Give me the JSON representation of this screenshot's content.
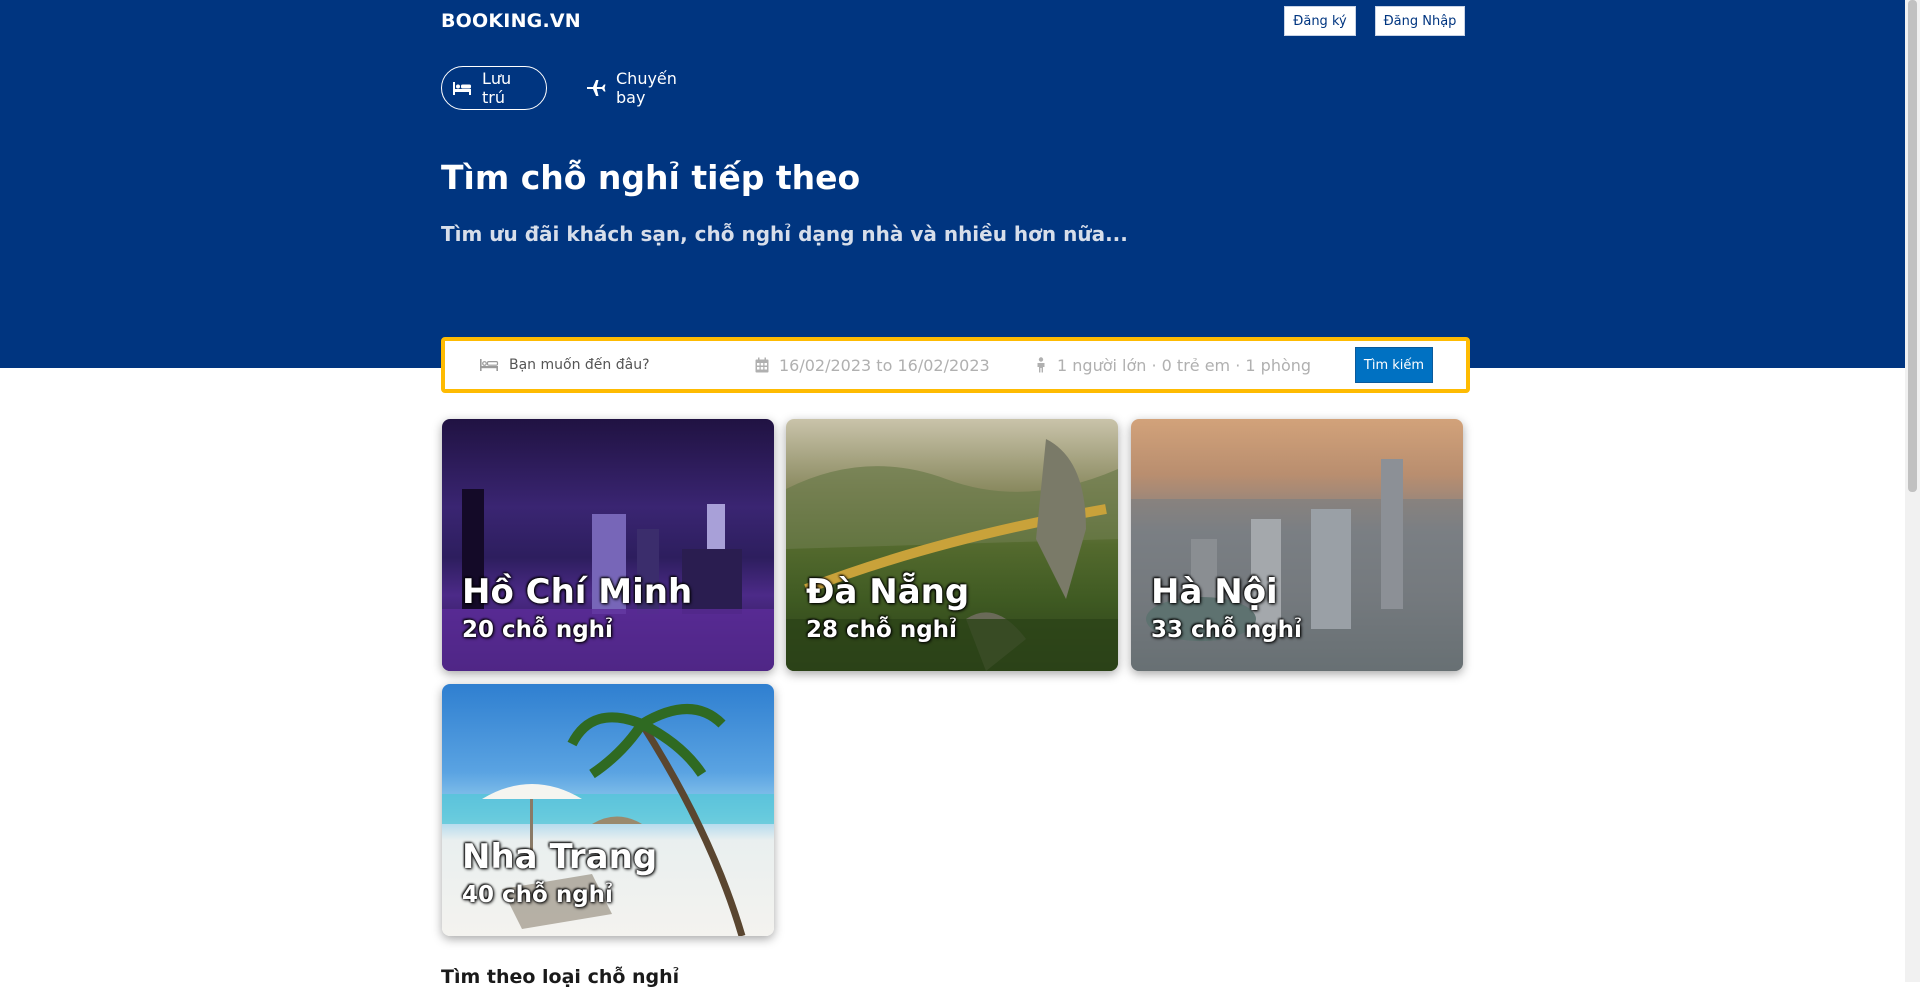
{
  "header": {
    "brand": "BOOKING.VN",
    "register_label": "Đăng ký",
    "login_label": "Đăng Nhập"
  },
  "nav": {
    "tabs": [
      {
        "label": "Lưu trú",
        "icon": "bed-icon",
        "active": true
      },
      {
        "label": "Chuyến bay",
        "icon": "plane-icon",
        "active": false
      }
    ]
  },
  "hero": {
    "title": "Tìm chỗ nghỉ tiếp theo",
    "subtitle": "Tìm ưu đãi khách sạn, chỗ nghỉ dạng nhà và nhiều hơn nữa..."
  },
  "search": {
    "destination_placeholder": "Bạn muốn đến đâu?",
    "dates": "16/02/2023 to 16/02/2023",
    "guests": "1 người lớn · 0 trẻ em · 1 phòng",
    "button_label": "Tìm kiếm"
  },
  "destinations": [
    {
      "name": "Hồ Chí Minh",
      "count": "20 chỗ nghỉ"
    },
    {
      "name": "Đà Nẵng",
      "count": "28 chỗ nghỉ"
    },
    {
      "name": "Hà Nội",
      "count": "33 chỗ nghỉ"
    },
    {
      "name": "Nha Trang",
      "count": "40 chỗ nghỉ"
    }
  ],
  "sections": {
    "property_type_title": "Tìm theo loại chỗ nghỉ"
  },
  "colors": {
    "hero_bg": "#003580",
    "search_border": "#febb02",
    "search_button": "#0071c2"
  }
}
